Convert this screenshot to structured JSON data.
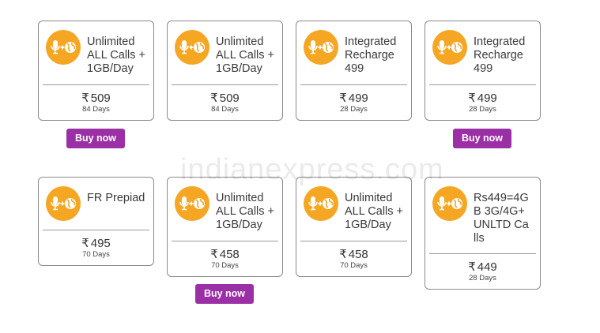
{
  "currency_symbol": "₹",
  "colors": {
    "icon_bg": "#f5a623",
    "button_bg": "#9b2fa5",
    "card_border": "#8a8a8a"
  },
  "icon_name": "voice-plus-data-icon",
  "buy_label": "Buy now",
  "watermark": {
    "pre": "indianexpress",
    "dot": ".",
    "post": "com"
  },
  "plans": [
    {
      "name": "Unlimited ALL Calls + 1GB/Day",
      "price": "509",
      "validity": "84 Days"
    },
    {
      "name": "Unlimited ALL Calls + 1GB/Day",
      "price": "509",
      "validity": "84 Days"
    },
    {
      "name": "Integrated Recharge 499",
      "price": "499",
      "validity": "28 Days"
    },
    {
      "name": "Integrated Recharge 499",
      "price": "499",
      "validity": "28 Days"
    },
    {
      "name": "FR Prepiad",
      "price": "495",
      "validity": "70 Days"
    },
    {
      "name": "Unlimited ALL Calls + 1GB/Day",
      "price": "458",
      "validity": "70 Days"
    },
    {
      "name": "Unlimited ALL Calls + 1GB/Day",
      "price": "458",
      "validity": "70 Days"
    },
    {
      "name": "Rs449=4GB 3G/4G+UNLTD Calls",
      "price": "449",
      "validity": "28 Days"
    }
  ]
}
